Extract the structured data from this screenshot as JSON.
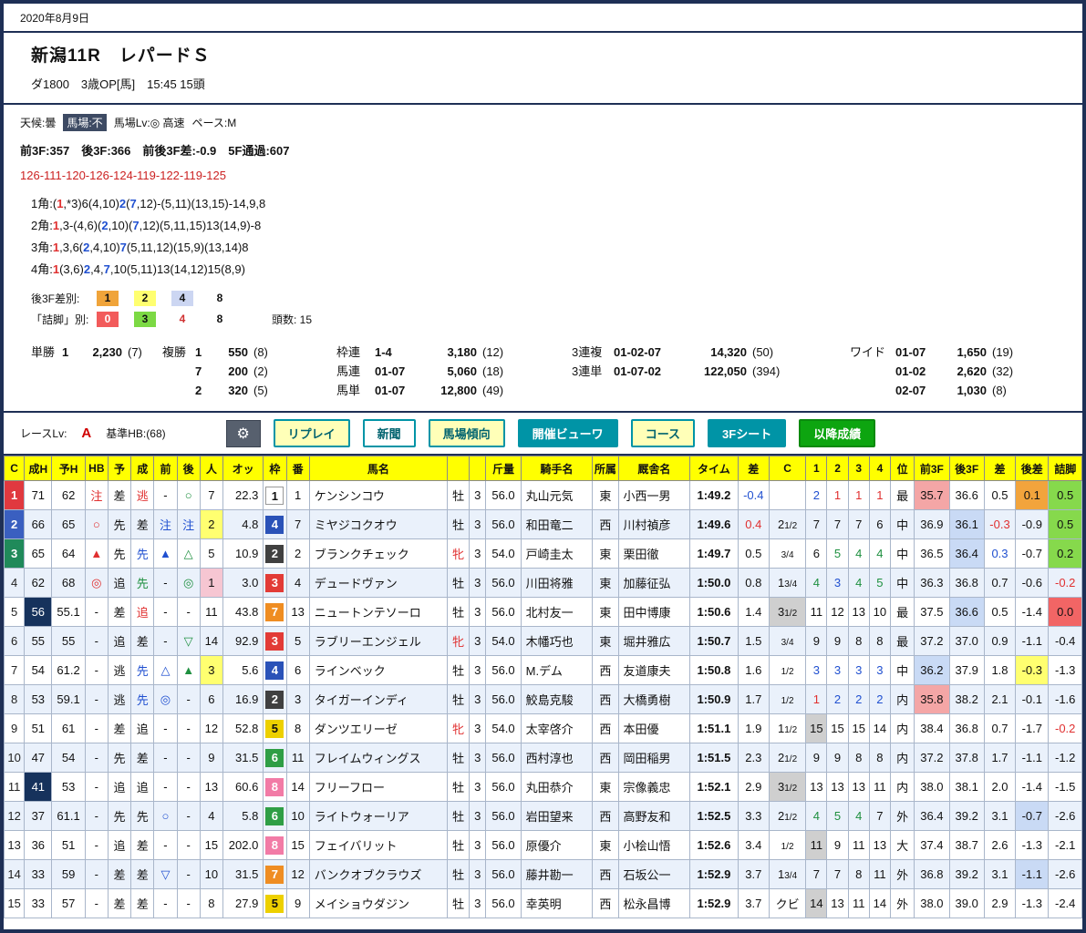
{
  "page": {
    "date": "2020年8月9日"
  },
  "header": {
    "race": "新潟11R　レパードＳ",
    "sub": "ダ1800　3歳OP[馬]　15:45 15頭"
  },
  "conditions": {
    "weather": "天候:曇",
    "track_chip": "馬場:不",
    "track_lv": "馬場Lv:◎ 高速",
    "pace": "ペース:M",
    "pace_line": "前3F:357　後3F:366　前後3F差:-0.9　5F通過:607",
    "laps": "126-111-120-126-124-119-122-119-125",
    "corners": [
      "1角:(1,*3)6(4,10)2(7,12)-(5,11)(13,15)-14,9,8",
      "2角:1,3-(4,6)(2,10)(7,12)(5,11,15)13(14,9)-8",
      "3角:1,3,6(2,4,10)7(5,11,12)(15,9)(13,14)8",
      "4角:1(3,6)2,4,7,10(5,11)13(14,12)15(8,9)"
    ],
    "corner_highlight": {
      "red": [
        "1"
      ],
      "blue": [
        "2",
        "7"
      ]
    }
  },
  "legend": {
    "rows": [
      {
        "label": "後3F差別:",
        "items": [
          {
            "t": "1",
            "bg": "#f0a43a",
            "color": "#111"
          },
          {
            "t": "2",
            "bg": "#ffff70",
            "color": "#111"
          },
          {
            "t": "4",
            "bg": "#ccd6f2",
            "color": "#111"
          },
          {
            "t": "8",
            "bg": "",
            "color": "#111"
          }
        ]
      },
      {
        "label": "「詰脚」別:",
        "items": [
          {
            "t": "0",
            "bg": "#f25b5b",
            "color": "#fff"
          },
          {
            "t": "3",
            "bg": "#7cd944",
            "color": "#111"
          },
          {
            "t": "4",
            "bg": "",
            "color": "#d03030"
          },
          {
            "t": "8",
            "bg": "",
            "color": "#111"
          }
        ],
        "extra": "頭数:  15"
      }
    ]
  },
  "payouts": {
    "tansho": {
      "label": "単勝",
      "num": "1",
      "amount": "2,230",
      "pop": "(7)"
    },
    "fukusho": {
      "label": "複勝",
      "rows": [
        {
          "num": "1",
          "amount": "550",
          "pop": "(8)"
        },
        {
          "num": "7",
          "amount": "200",
          "pop": "(2)"
        },
        {
          "num": "2",
          "amount": "320",
          "pop": "(5)"
        }
      ]
    },
    "col2": [
      {
        "label": "枠連",
        "combo": "1-4",
        "amount": "3,180",
        "pop": "(12)"
      },
      {
        "label": "馬連",
        "combo": "01-07",
        "amount": "5,060",
        "pop": "(18)"
      },
      {
        "label": "馬単",
        "combo": "01-07",
        "amount": "12,800",
        "pop": "(49)"
      }
    ],
    "col3": [
      {
        "label": "3連複",
        "combo": "01-02-07",
        "amount": "14,320",
        "pop": "(50)"
      },
      {
        "label": "3連単",
        "combo": "01-07-02",
        "amount": "122,050",
        "pop": "(394)"
      }
    ],
    "col4": [
      {
        "label": "ワイド",
        "combo": "01-07",
        "amount": "1,650",
        "pop": "(19)"
      },
      {
        "label": "",
        "combo": "01-02",
        "amount": "2,620",
        "pop": "(32)"
      },
      {
        "label": "",
        "combo": "02-07",
        "amount": "1,030",
        "pop": "(8)"
      }
    ]
  },
  "toolbar": {
    "race_lv_label": "レースLv:",
    "race_lv": "A",
    "base_hb": "基準HB:(68)",
    "gear_icon": "⚙",
    "buttons": [
      {
        "label": "リプレイ",
        "style": "yellow",
        "name": "replay-button"
      },
      {
        "label": "新聞",
        "style": "white",
        "name": "newspaper-button"
      },
      {
        "label": "馬場傾向",
        "style": "yellow",
        "name": "track-trend-button"
      },
      {
        "label": "開催ビューワ",
        "style": "teal",
        "name": "meeting-viewer-button"
      },
      {
        "label": "コース",
        "style": "yellow",
        "name": "course-button"
      },
      {
        "label": "3Fシート",
        "style": "teal",
        "name": "3f-sheet-button"
      },
      {
        "label": "以降成績",
        "style": "green",
        "name": "after-results-button"
      }
    ]
  },
  "colors": {
    "frame_navy": "#1e2f55",
    "header_yellow": "#ffff00",
    "accent_teal": "#0094a6",
    "accent_green": "#0da510",
    "race_lv_red": "#d00000",
    "lap_red": "#cc2222",
    "mark_red": "#e03030",
    "mark_blue": "#2050d0",
    "mark_green": "#1f9040",
    "sei_h_dark": "#16325c",
    "stripe_blue": "#eaf1fb",
    "pos": {
      "1": "#e0393f",
      "2": "#3a5fc0",
      "3": "#208a5a"
    },
    "waku": {
      "1": "#ffffff",
      "2": "#404040",
      "3": "#e23b36",
      "4": "#2a52b8",
      "5": "#edd000",
      "6": "#2f9e45",
      "7": "#ef8d22",
      "8": "#f27ba6"
    },
    "cell": {
      "red": "#f4a6a6",
      "blue": "#c9daf5",
      "orange": "#f2a43c",
      "yellow": "#ffff70",
      "green": "#86d94c",
      "gray": "#cfcfcf",
      "pink": "#f6c6d2",
      "redstrong": "#f26565"
    }
  },
  "table": {
    "headers": [
      "C",
      "成H",
      "予H",
      "HB",
      "予",
      "成",
      "前",
      "後",
      "人",
      "オッ",
      "枠",
      "番",
      "馬名",
      "",
      "",
      "斤量",
      "騎手名",
      "所属",
      "厩舎名",
      "タイム",
      "差",
      "C",
      "1",
      "2",
      "3",
      "4",
      "位",
      "前3F",
      "後3F",
      "差",
      "後差",
      "詰脚"
    ],
    "rows": [
      {
        "pos": "1",
        "sh": "71",
        "yh": "62",
        "hb": "注",
        "yo": "差",
        "sei": "逃",
        "seiC": "red",
        "mae": "-",
        "ato": "○",
        "pop": "7",
        "odds": "22.3",
        "waku": 1,
        "num": "1",
        "name": "ケンシンコウ",
        "sex": "牡",
        "age": "3",
        "kin": "56.0",
        "jockey": "丸山元気",
        "area": "東",
        "stable": "小西一男",
        "time": "1:49.2",
        "diff": "-0.4",
        "diffC": "blue",
        "mgn": "",
        "c": [
          "2",
          "1",
          "1",
          "1"
        ],
        "ichi": "最",
        "f1": "35.7",
        "f1Bg": "red",
        "f2": "36.6",
        "fd": "0.5",
        "ad": "0.1",
        "adBg": "orange",
        "tt": "0.5",
        "ttBg": "green"
      },
      {
        "pos": "2",
        "sh": "66",
        "yh": "65",
        "hb": "○",
        "yo": "先",
        "sei": "差",
        "mae": "注",
        "ato": "注",
        "pop": "2",
        "odds": "4.8",
        "waku": 4,
        "num": "7",
        "name": "ミヤジコクオウ",
        "sex": "牡",
        "age": "3",
        "kin": "56.0",
        "jockey": "和田竜二",
        "area": "西",
        "stable": "川村禎彦",
        "time": "1:49.6",
        "diff": "0.4",
        "diffC": "red",
        "mgn": "21/2",
        "c": [
          "7",
          "7",
          "7",
          "6"
        ],
        "ichi": "中",
        "f1": "36.9",
        "f2": "36.1",
        "f2Bg": "blue",
        "fd": "-0.3",
        "fdC": "red",
        "ad": "-0.9",
        "tt": "0.5",
        "ttBg": "green"
      },
      {
        "pos": "3",
        "sh": "65",
        "yh": "64",
        "hb": "▲",
        "yo": "先",
        "sei": "先",
        "seiC": "blue",
        "mae": "▲",
        "ato": "△",
        "pop": "5",
        "odds": "10.9",
        "waku": 2,
        "num": "2",
        "name": "ブランクチェック",
        "sex": "牝",
        "age": "3",
        "kin": "54.0",
        "jockey": "戸崎圭太",
        "area": "東",
        "stable": "栗田徹",
        "time": "1:49.7",
        "diff": "0.5",
        "mgn": "3/4",
        "c": [
          "6",
          "5",
          "4",
          "4"
        ],
        "ichi": "中",
        "f1": "36.5",
        "f2": "36.4",
        "f2Bg": "blue",
        "fd": "0.3",
        "fdC": "blue",
        "ad": "-0.7",
        "tt": "0.2",
        "ttBg": "green"
      },
      {
        "pos": "4",
        "sh": "62",
        "yh": "68",
        "hb": "◎",
        "yo": "追",
        "sei": "先",
        "seiC": "green",
        "mae": "-",
        "ato": "◎",
        "pop": "1",
        "odds": "3.0",
        "waku": 3,
        "num": "4",
        "name": "デュードヴァン",
        "sex": "牡",
        "age": "3",
        "kin": "56.0",
        "jockey": "川田将雅",
        "area": "東",
        "stable": "加藤征弘",
        "time": "1:50.0",
        "diff": "0.8",
        "mgn": "13/4",
        "c": [
          "4",
          "3",
          "4",
          "5"
        ],
        "ichi": "中",
        "f1": "36.3",
        "f2": "36.8",
        "fd": "0.7",
        "ad": "-0.6",
        "tt": "-0.2",
        "ttC": "red"
      },
      {
        "pos": "5",
        "sh": "56",
        "shD": true,
        "yh": "55.1",
        "hb": "-",
        "yo": "差",
        "sei": "追",
        "seiC": "red",
        "mae": "-",
        "ato": "-",
        "pop": "11",
        "odds": "43.8",
        "waku": 7,
        "num": "13",
        "name": "ニュートンテソーロ",
        "sex": "牡",
        "age": "3",
        "kin": "56.0",
        "jockey": "北村友一",
        "area": "東",
        "stable": "田中博康",
        "time": "1:50.6",
        "diff": "1.4",
        "mgn": "31/2",
        "mgnBg": "gray",
        "c": [
          "11",
          "12",
          "13",
          "10"
        ],
        "ichi": "最",
        "f1": "37.5",
        "f2": "36.6",
        "f2Bg": "blue",
        "fd": "0.5",
        "ad": "-1.4",
        "tt": "0.0",
        "ttBg": "redstrong"
      },
      {
        "pos": "6",
        "sh": "55",
        "yh": "55",
        "hb": "-",
        "yo": "追",
        "sei": "差",
        "mae": "-",
        "ato": "▽",
        "pop": "14",
        "odds": "92.9",
        "waku": 3,
        "num": "5",
        "name": "ラブリーエンジェル",
        "sex": "牝",
        "age": "3",
        "kin": "54.0",
        "jockey": "木幡巧也",
        "area": "東",
        "stable": "堀井雅広",
        "time": "1:50.7",
        "diff": "1.5",
        "mgn": "3/4",
        "c": [
          "9",
          "9",
          "8",
          "8"
        ],
        "ichi": "最",
        "f1": "37.2",
        "f2": "37.0",
        "fd": "0.9",
        "ad": "-1.1",
        "tt": "-0.4"
      },
      {
        "pos": "7",
        "sh": "54",
        "yh": "61.2",
        "hb": "-",
        "yo": "逃",
        "sei": "先",
        "seiC": "blue",
        "mae": "△",
        "ato": "▲",
        "pop": "3",
        "odds": "5.6",
        "waku": 4,
        "num": "6",
        "name": "ラインベック",
        "sex": "牡",
        "age": "3",
        "kin": "56.0",
        "jockey": "M.デム",
        "area": "西",
        "stable": "友道康夫",
        "time": "1:50.8",
        "diff": "1.6",
        "mgn": "1/2",
        "c": [
          "3",
          "3",
          "3",
          "3"
        ],
        "ichi": "中",
        "f1": "36.2",
        "f1Bg": "blue",
        "f2": "37.9",
        "fd": "1.8",
        "ad": "-0.3",
        "adBg": "yellow",
        "tt": "-1.3"
      },
      {
        "pos": "8",
        "sh": "53",
        "yh": "59.1",
        "hb": "-",
        "yo": "逃",
        "sei": "先",
        "seiC": "blue",
        "mae": "◎",
        "ato": "-",
        "pop": "6",
        "odds": "16.9",
        "waku": 2,
        "num": "3",
        "name": "タイガーインディ",
        "sex": "牡",
        "age": "3",
        "kin": "56.0",
        "jockey": "鮫島克駿",
        "area": "西",
        "stable": "大橋勇樹",
        "time": "1:50.9",
        "diff": "1.7",
        "mgn": "1/2",
        "c": [
          "1",
          "2",
          "2",
          "2"
        ],
        "ichi": "内",
        "f1": "35.8",
        "f1Bg": "red",
        "f2": "38.2",
        "fd": "2.1",
        "ad": "-0.1",
        "tt": "-1.6"
      },
      {
        "pos": "9",
        "sh": "51",
        "yh": "61",
        "hb": "-",
        "yo": "差",
        "sei": "追",
        "mae": "-",
        "ato": "-",
        "pop": "12",
        "odds": "52.8",
        "waku": 5,
        "num": "8",
        "name": "ダンツエリーゼ",
        "sex": "牝",
        "age": "3",
        "kin": "54.0",
        "jockey": "太宰啓介",
        "area": "西",
        "stable": "本田優",
        "time": "1:51.1",
        "diff": "1.9",
        "mgn": "11/2",
        "c": [
          "15",
          "15",
          "15",
          "14"
        ],
        "c1Bg": "gray",
        "ichi": "内",
        "f1": "38.4",
        "f2": "36.8",
        "fd": "0.7",
        "ad": "-1.7",
        "tt": "-0.2",
        "ttC": "red"
      },
      {
        "pos": "10",
        "sh": "47",
        "yh": "54",
        "hb": "-",
        "yo": "先",
        "sei": "差",
        "mae": "-",
        "ato": "-",
        "pop": "9",
        "odds": "31.5",
        "waku": 6,
        "num": "11",
        "name": "フレイムウィングス",
        "sex": "牡",
        "age": "3",
        "kin": "56.0",
        "jockey": "西村淳也",
        "area": "西",
        "stable": "岡田稲男",
        "time": "1:51.5",
        "diff": "2.3",
        "mgn": "21/2",
        "c": [
          "9",
          "9",
          "8",
          "8"
        ],
        "ichi": "内",
        "f1": "37.2",
        "f2": "37.8",
        "fd": "1.7",
        "ad": "-1.1",
        "tt": "-1.2"
      },
      {
        "pos": "11",
        "sh": "41",
        "shD": true,
        "yh": "53",
        "hb": "-",
        "yo": "追",
        "sei": "追",
        "mae": "-",
        "ato": "-",
        "pop": "13",
        "odds": "60.6",
        "waku": 8,
        "num": "14",
        "name": "フリーフロー",
        "sex": "牡",
        "age": "3",
        "kin": "56.0",
        "jockey": "丸田恭介",
        "area": "東",
        "stable": "宗像義忠",
        "time": "1:52.1",
        "diff": "2.9",
        "mgn": "31/2",
        "mgnBg": "gray",
        "c": [
          "13",
          "13",
          "13",
          "11"
        ],
        "ichi": "内",
        "f1": "38.0",
        "f2": "38.1",
        "fd": "2.0",
        "ad": "-1.4",
        "tt": "-1.5"
      },
      {
        "pos": "12",
        "sh": "37",
        "yh": "61.1",
        "hb": "-",
        "yo": "先",
        "sei": "先",
        "mae": "○",
        "ato": "-",
        "pop": "4",
        "odds": "5.8",
        "waku": 6,
        "num": "10",
        "name": "ライトウォーリア",
        "sex": "牡",
        "age": "3",
        "kin": "56.0",
        "jockey": "岩田望来",
        "area": "西",
        "stable": "高野友和",
        "time": "1:52.5",
        "diff": "3.3",
        "mgn": "21/2",
        "c": [
          "4",
          "5",
          "4",
          "7"
        ],
        "ichi": "外",
        "f1": "36.4",
        "f2": "39.2",
        "fd": "3.1",
        "ad": "-0.7",
        "adBg": "blue",
        "tt": "-2.6"
      },
      {
        "pos": "13",
        "sh": "36",
        "yh": "51",
        "hb": "-",
        "yo": "追",
        "sei": "差",
        "mae": "-",
        "ato": "-",
        "pop": "15",
        "odds": "202.0",
        "waku": 8,
        "num": "15",
        "name": "フェイバリット",
        "sex": "牡",
        "age": "3",
        "kin": "56.0",
        "jockey": "原優介",
        "area": "東",
        "stable": "小桧山悟",
        "time": "1:52.6",
        "diff": "3.4",
        "mgn": "1/2",
        "c": [
          "11",
          "9",
          "11",
          "13"
        ],
        "c1Bg": "gray",
        "ichi": "大",
        "f1": "37.4",
        "f2": "38.7",
        "fd": "2.6",
        "ad": "-1.3",
        "tt": "-2.1"
      },
      {
        "pos": "14",
        "sh": "33",
        "yh": "59",
        "hb": "-",
        "yo": "差",
        "sei": "差",
        "mae": "▽",
        "ato": "-",
        "pop": "10",
        "odds": "31.5",
        "waku": 7,
        "num": "12",
        "name": "バンクオブクラウズ",
        "sex": "牡",
        "age": "3",
        "kin": "56.0",
        "jockey": "藤井勘一",
        "area": "西",
        "stable": "石坂公一",
        "time": "1:52.9",
        "diff": "3.7",
        "mgn": "13/4",
        "c": [
          "7",
          "7",
          "8",
          "11"
        ],
        "ichi": "外",
        "f1": "36.8",
        "f2": "39.2",
        "fd": "3.1",
        "ad": "-1.1",
        "adBg": "blue",
        "tt": "-2.6"
      },
      {
        "pos": "15",
        "sh": "33",
        "yh": "57",
        "hb": "-",
        "yo": "差",
        "sei": "差",
        "mae": "-",
        "ato": "-",
        "pop": "8",
        "odds": "27.9",
        "waku": 5,
        "num": "9",
        "name": "メイショウダジン",
        "sex": "牡",
        "age": "3",
        "kin": "56.0",
        "jockey": "幸英明",
        "area": "西",
        "stable": "松永昌博",
        "time": "1:52.9",
        "diff": "3.7",
        "mgn": "クビ",
        "c": [
          "14",
          "13",
          "11",
          "14"
        ],
        "c1Bg": "gray",
        "ichi": "外",
        "f1": "38.0",
        "f2": "39.0",
        "fd": "2.9",
        "ad": "-1.3",
        "tt": "-2.4"
      }
    ]
  }
}
